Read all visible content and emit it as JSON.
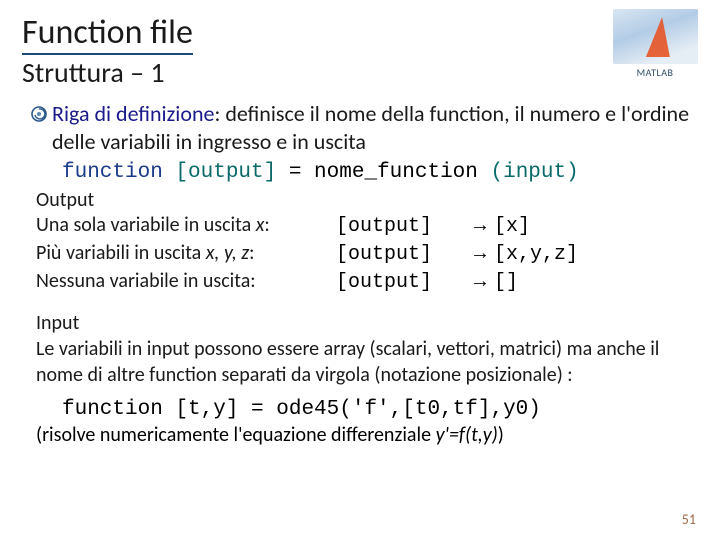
{
  "title": "Function file",
  "subtitle": "Struttura – 1",
  "logo_text": "MATLAB",
  "bullet": {
    "riga": "Riga di definizione",
    "rest": ": definisce il nome della function, il numero e l'ordine delle variabili in ingresso e in uscita"
  },
  "syntax": {
    "kw": "function ",
    "out": "[output]",
    "eq": " = nome_function ",
    "in": "(input)"
  },
  "output_head": "Output",
  "output_rows": [
    {
      "label_a": "Una sola variabile in uscita ",
      "label_b": "x",
      "label_c": ":",
      "src": "[output]",
      "arrow": "→",
      "dst": "[x]"
    },
    {
      "label_a": "Più variabili in uscita ",
      "label_b": "x, y, z",
      "label_c": ":",
      "src": "[output]",
      "arrow": "→",
      "dst": "[x,y,z]"
    },
    {
      "label_a": "Nessuna variabile in uscita:",
      "label_b": "",
      "label_c": "",
      "src": "[output]",
      "arrow": "→",
      "dst": "[]"
    }
  ],
  "input_head": "Input",
  "input_body": "Le variabili in input possono essere array (scalari, vettori, matrici) ma anche il nome di altre function separati da virgola (notazione posizionale) :",
  "example": "function [t,y] = ode45('f',[t0,tf],y0)",
  "footnote_a": "(risolve numericamente l'equazione differenziale ",
  "footnote_b": "y'=f(t,y)",
  "footnote_c": ")",
  "slide_num": "51"
}
